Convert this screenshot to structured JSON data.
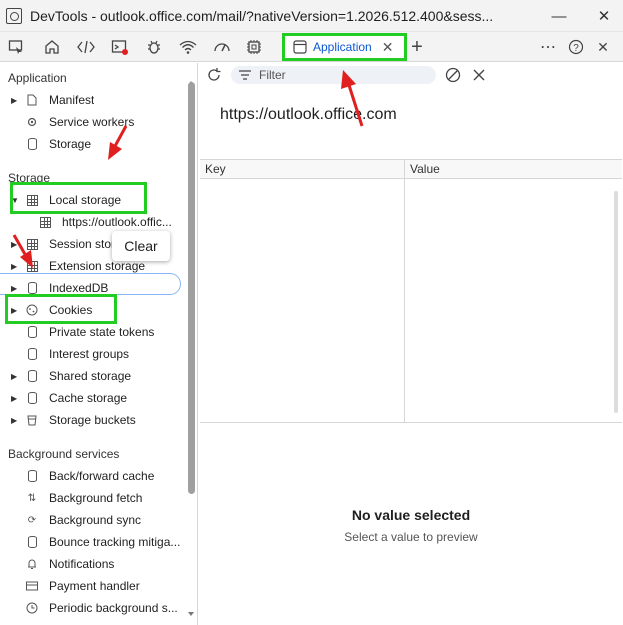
{
  "window": {
    "title": "DevTools - outlook.office.com/mail/?nativeVersion=1.2026.512.400&sess...",
    "minimize_glyph": "—",
    "close_glyph": "✕"
  },
  "toolbar": {
    "icons": [
      "inspect-icon",
      "welcome-icon",
      "elements-icon",
      "console-icon",
      "bug-icon",
      "network-icon",
      "performance-icon",
      "memory-icon"
    ],
    "active_tab": "Application",
    "more_glyph": "⋯",
    "help_glyph": "?",
    "close_glyph": "✕",
    "add_glyph": "+",
    "tab_close_glyph": "✕"
  },
  "sidebar": {
    "sections": {
      "application": "Application",
      "storage": "Storage",
      "background": "Background services"
    },
    "application_items": [
      {
        "label": "Manifest",
        "icon": "file-icon",
        "expandable": true
      },
      {
        "label": "Service workers",
        "icon": "gear-icon",
        "expandable": false
      },
      {
        "label": "Storage",
        "icon": "database-icon",
        "expandable": false
      }
    ],
    "storage_items": [
      {
        "label": "Local storage",
        "icon": "table-icon",
        "expandable": true
      },
      {
        "label": "https://outlook.offic...",
        "icon": "table-icon",
        "expandable": false
      },
      {
        "label": "Session stora...",
        "icon": "table-icon",
        "expandable": true
      },
      {
        "label": "Extension storage",
        "icon": "table-icon",
        "expandable": true
      },
      {
        "label": "IndexedDB",
        "icon": "database-icon",
        "expandable": true
      },
      {
        "label": "Cookies",
        "icon": "cookie-icon",
        "expandable": true
      },
      {
        "label": "Private state tokens",
        "icon": "database-icon",
        "expandable": false
      },
      {
        "label": "Interest groups",
        "icon": "database-icon",
        "expandable": false
      },
      {
        "label": "Shared storage",
        "icon": "database-icon",
        "expandable": true
      },
      {
        "label": "Cache storage",
        "icon": "database-icon",
        "expandable": true
      },
      {
        "label": "Storage buckets",
        "icon": "bucket-icon",
        "expandable": true
      }
    ],
    "background_items": [
      {
        "label": "Back/forward cache",
        "icon": "database-icon"
      },
      {
        "label": "Background fetch",
        "icon": "updown-icon"
      },
      {
        "label": "Background sync",
        "icon": "sync-icon"
      },
      {
        "label": "Bounce tracking mitiga...",
        "icon": "database-icon"
      },
      {
        "label": "Notifications",
        "icon": "bell-icon"
      },
      {
        "label": "Payment handler",
        "icon": "card-icon"
      },
      {
        "label": "Periodic background s...",
        "icon": "clock-icon"
      }
    ],
    "context_menu": {
      "clear": "Clear"
    }
  },
  "main": {
    "filter_placeholder": "Filter",
    "origin": "https://outlook.office.com",
    "columns": {
      "key": "Key",
      "value": "Value"
    },
    "empty_title": "No value selected",
    "empty_subtitle": "Select a value to preview"
  },
  "colors": {
    "highlight_green": "#22cc22",
    "annotation_red": "#e02020",
    "accent_blue": "#0b57d0"
  }
}
